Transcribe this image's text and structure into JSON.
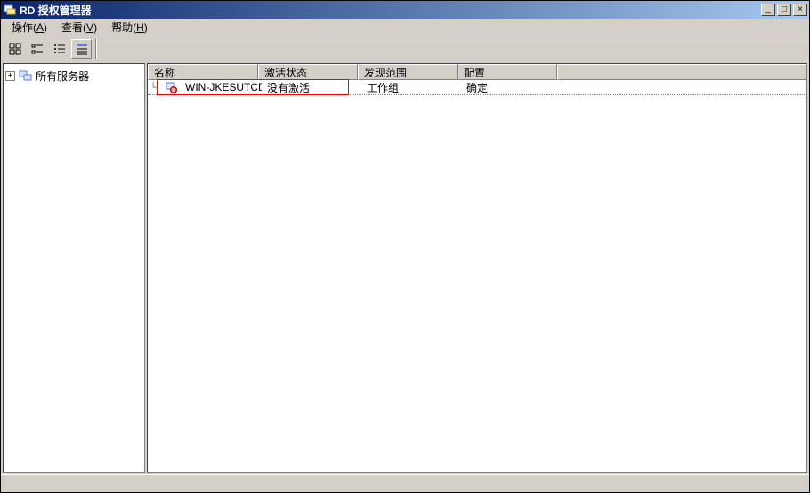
{
  "title": "RD 授权管理器",
  "menu": {
    "action": "操作",
    "action_key": "A",
    "view": "查看",
    "view_key": "V",
    "help": "帮助",
    "help_key": "H"
  },
  "tree": {
    "root": "所有服务器"
  },
  "columns": {
    "name": "名称",
    "activate": "激活状态",
    "scope": "发现范围",
    "config": "配置"
  },
  "rows": [
    {
      "name": "WIN-JKESUTCDKFE",
      "activate": "没有激活",
      "scope": "工作组",
      "config": "确定"
    }
  ],
  "winctrl": {
    "min": "_",
    "max": "□",
    "close": "×"
  }
}
